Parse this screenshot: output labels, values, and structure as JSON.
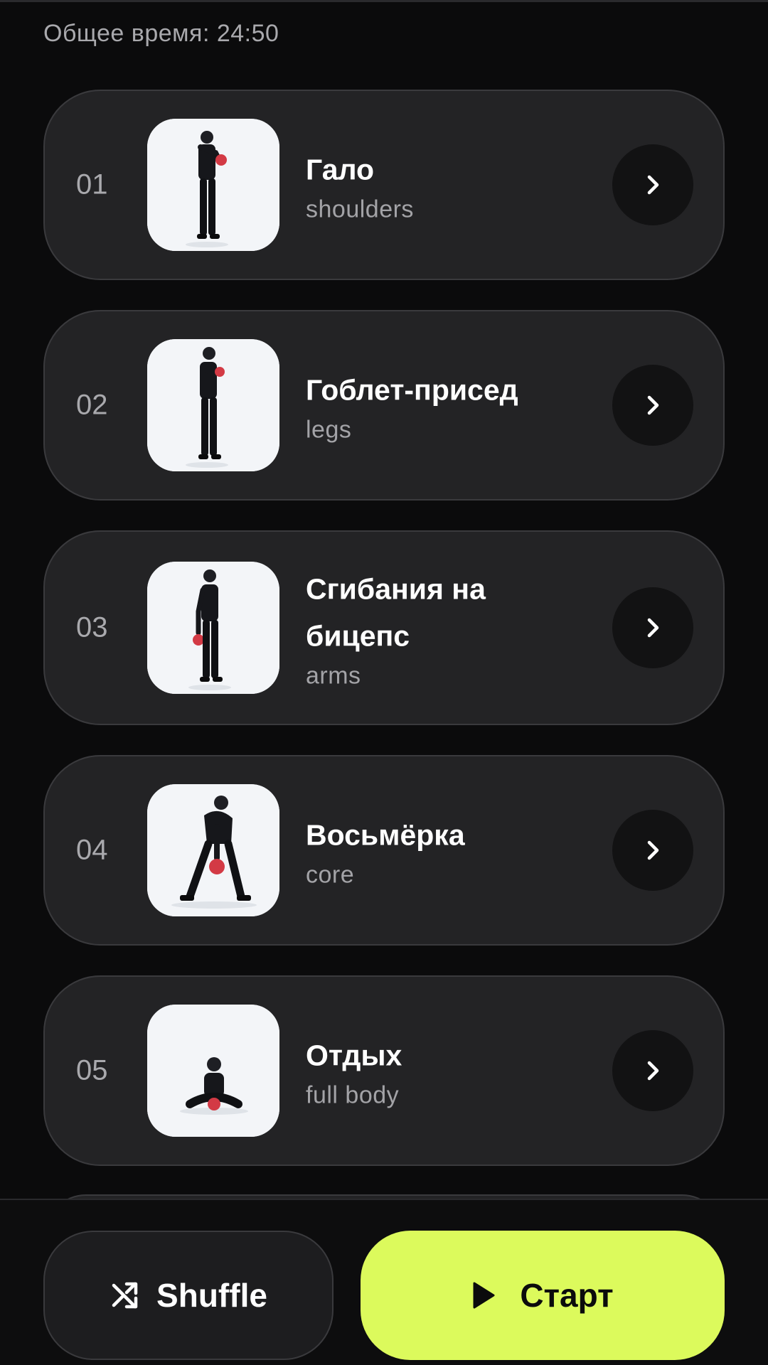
{
  "header": {
    "total_time": "Общее время: 24:50"
  },
  "exercises": [
    {
      "number": "01",
      "title": "Гало",
      "muscle_group": "shoulders",
      "pose": "standing-halo"
    },
    {
      "number": "02",
      "title": "Гоблет-присед",
      "muscle_group": "legs",
      "pose": "standing-goblet"
    },
    {
      "number": "03",
      "title": "Сгибания на бицепс",
      "muscle_group": "arms",
      "pose": "standing-curl"
    },
    {
      "number": "04",
      "title": "Восьмёрка",
      "muscle_group": "core",
      "pose": "bent-figure-eight"
    },
    {
      "number": "05",
      "title": "Отдых",
      "muscle_group": "full body",
      "pose": "seated-rest"
    }
  ],
  "actions": {
    "shuffle_label": "Shuffle",
    "start_label": "Старт"
  },
  "icons": {
    "row_action": "chevron-right-icon",
    "shuffle": "shuffle-icon",
    "start": "play-icon"
  },
  "colors": {
    "background": "#0b0b0c",
    "card": "#232325",
    "accent": "#dcfa5c",
    "kettlebell": "#d33a45"
  }
}
